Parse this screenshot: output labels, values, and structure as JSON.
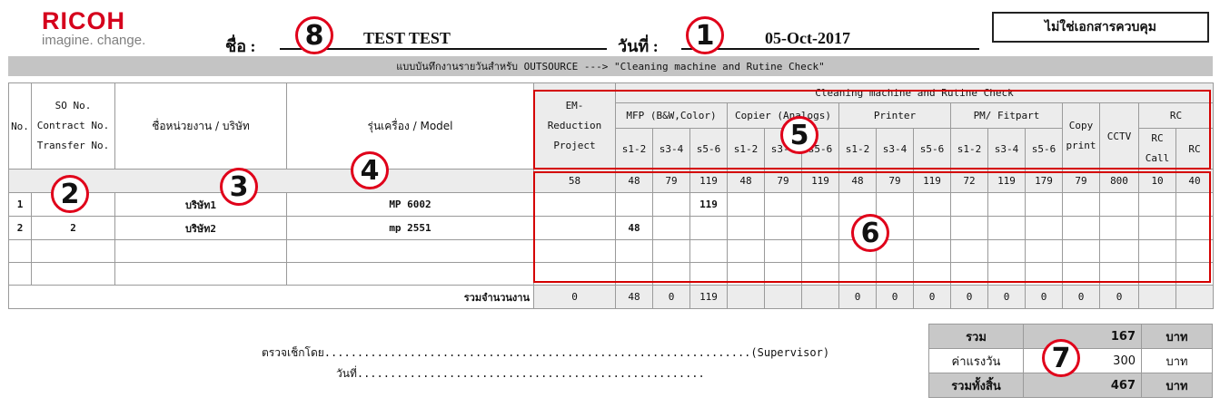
{
  "logo": {
    "name": "RICOH",
    "tagline": "imagine. change."
  },
  "header": {
    "name_label": "ชื่อ :",
    "name_value": "TEST TEST",
    "date_label": "วันที่ :",
    "date_value": "05-Oct-2017",
    "badge": "ไม่ใช่เอกสารควบคุม"
  },
  "title": "แบบบันทึกงานรายวันสำหรับ OUTSOURCE ---> \"Cleaning machine and Rutine Check\"",
  "table": {
    "col_no": "No.",
    "col_so": [
      "SO No.",
      "Contract No.",
      "Transfer No."
    ],
    "col_company": "ชื่อหน่วยงาน / บริษัท",
    "col_model": "รุ่นเครื่อง / Model",
    "col_em": [
      "EM-",
      "Reduction",
      "Project"
    ],
    "group_title": "Cleaning machine and Rutine Check",
    "groups": {
      "mfp": "MFP (B&W,Color)",
      "copier": "Copier (Analogs)",
      "printer": "Printer",
      "pm": "PM/ Fitpart",
      "copy_print": [
        "Copy",
        "print"
      ],
      "cctv": "CCTV",
      "rc": "RC"
    },
    "subheads": [
      "s1-2",
      "s3-4",
      "s5-6",
      "s1-2",
      "s3-4",
      "s5-6",
      "s1-2",
      "s3-4",
      "s5-6",
      "s1-2",
      "s3-4",
      "s5-6"
    ],
    "rc_subs": [
      [
        "RC",
        "Call"
      ],
      "RC"
    ],
    "rates": [
      "58",
      "48",
      "79",
      "119",
      "48",
      "79",
      "119",
      "48",
      "79",
      "119",
      "72",
      "119",
      "179",
      "79",
      "800",
      "10",
      "40"
    ],
    "rows": [
      {
        "no": "1",
        "so": "1",
        "company": "บริษัท1",
        "model": "MP 6002",
        "cells": [
          "",
          "",
          "",
          "119",
          "",
          "",
          "",
          "",
          "",
          "",
          "",
          "",
          "",
          "",
          "",
          "",
          ""
        ]
      },
      {
        "no": "2",
        "so": "2",
        "company": "บริษัท2",
        "model": "mp 2551",
        "cells": [
          "",
          "48",
          "",
          "",
          "",
          "",
          "",
          "",
          "",
          "",
          "",
          "",
          "",
          "",
          "",
          "",
          ""
        ]
      }
    ],
    "total_label": "รวมจำนวนงาน",
    "totals": [
      "0",
      "48",
      "0",
      "119",
      "",
      "",
      "",
      "0",
      "0",
      "0",
      "0",
      "0",
      "0",
      "0",
      "0",
      "",
      ""
    ]
  },
  "summary": {
    "r1": {
      "label": "รวม",
      "value": "167",
      "unit": "บาท"
    },
    "r2": {
      "label": "ค่าแรงวัน",
      "value": "300",
      "unit": "บาท"
    },
    "r3": {
      "label": "รวมทั้งสิ้น",
      "value": "467",
      "unit": "บาท"
    }
  },
  "signature": {
    "checked_by": "ตรวจเช็กโดย.................................................................(Supervisor)",
    "date_line": "วันที่....................................................."
  },
  "markers": [
    "1",
    "2",
    "3",
    "4",
    "5",
    "6",
    "7",
    "8"
  ]
}
